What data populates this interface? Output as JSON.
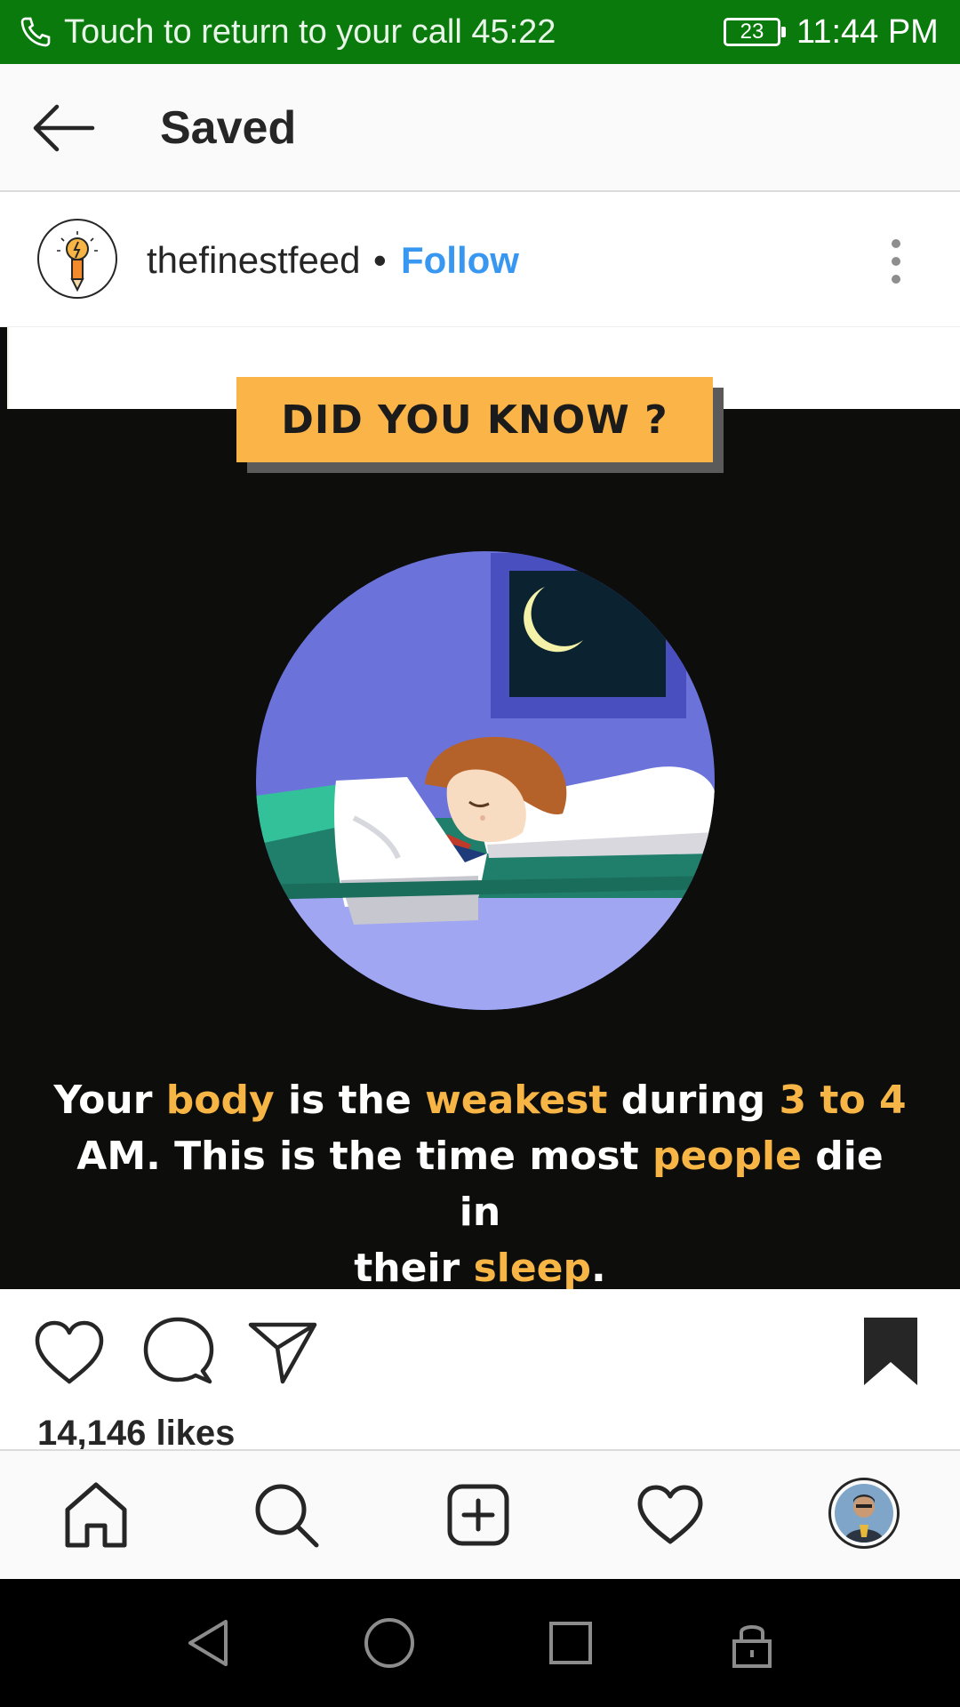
{
  "status_bar": {
    "call_text": "Touch to return to your call",
    "call_timer": "45:22",
    "battery": "23",
    "time": "11:44 PM",
    "color": "#0b7a0d"
  },
  "header": {
    "title": "Saved",
    "back_icon": "arrow-left-icon"
  },
  "post": {
    "username": "thefinestfeed",
    "separator": "•",
    "follow_label": "Follow",
    "follow_color": "#3897f0",
    "more_icon": "more-vertical-icon",
    "image": {
      "banner": "DID YOU KNOW ?",
      "banner_color": "#fbb447",
      "caption": {
        "line1": [
          "Your ",
          "body",
          " is the ",
          "weakest",
          " during ",
          "3 to 4"
        ],
        "line2": [
          "AM. This is the time most ",
          "people",
          " die in"
        ],
        "line3": [
          "their ",
          "sleep",
          "."
        ]
      },
      "highlight_color": "#f6b545"
    },
    "likes": "14,146 likes",
    "saved": true
  },
  "bottom_nav": {
    "items": [
      "home-icon",
      "search-icon",
      "add-post-icon",
      "activity-heart-icon",
      "profile-avatar"
    ]
  },
  "system_nav": {
    "items": [
      "back-triangle-icon",
      "home-circle-icon",
      "recent-square-icon",
      "lock-icon"
    ]
  }
}
